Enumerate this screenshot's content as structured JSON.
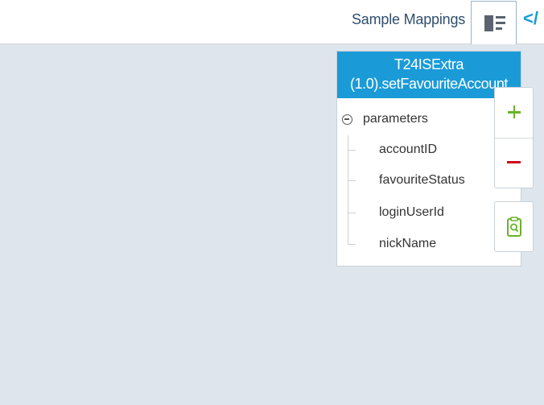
{
  "header": {
    "sample_mappings_label": "Sample Mappings",
    "code_toggle_label": "</"
  },
  "node": {
    "title_line1": "T24ISExtra",
    "title_line2": "(1.0).setFavouriteAccount",
    "root_label": "parameters",
    "fields": [
      "accountID",
      "favouriteStatus",
      "loginUserId",
      "nickName"
    ]
  },
  "icons": {
    "layout": "layout-toggle-icon",
    "collapse": "minus-circle-icon",
    "zoom_in": "plus-icon",
    "zoom_out": "minus-icon",
    "fit": "document-search-icon"
  },
  "colors": {
    "accent": "#1a9bd8",
    "canvas": "#dfe5ec",
    "zoom_in": "#6bb22a",
    "zoom_out": "#d0021b"
  }
}
